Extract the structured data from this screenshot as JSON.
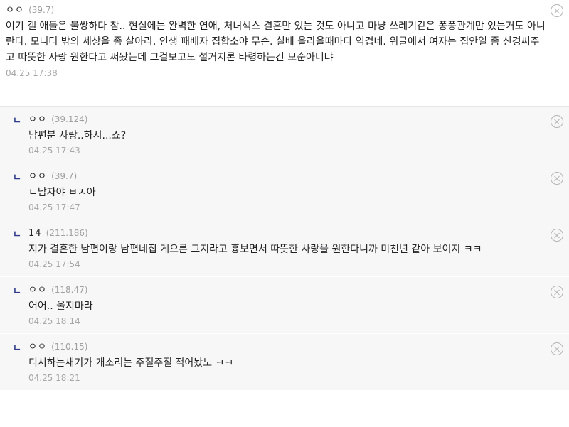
{
  "main_comment": {
    "author": "ㅇㅇ",
    "ip": "(39.7)",
    "text": "여기 갤 애들은 불쌍하다 참.. 현실에는 완벽한 연애, 처녀섹스 결혼만 있는 것도 아니고 마냥 쓰레기같은 퐁퐁관계만 있는거도 아니란다. 모니터 밖의 세상을 좀 살아라. 인생 패배자 집합소야 무슨. 실베 올라올때마다 역겹네. 위글에서 여자는 집안일 좀 신경써주고 따뜻한 사랑 원한다고 써놨는데 그걸보고도 설거지론 타령하는건 모순아니냐",
    "date": "04.25 17:38"
  },
  "replies": [
    {
      "arrow": "ㄴ",
      "author": "ㅇㅇ",
      "ip": "(39.124)",
      "text": "남편분 사랑..하시...죠?",
      "date": "04.25 17:43"
    },
    {
      "arrow": "ㄴ",
      "author": "ㅇㅇ",
      "ip": "(39.7)",
      "text": "ㄴ남자야 ㅂㅅ아",
      "date": "04.25 17:47"
    },
    {
      "arrow": "ㄴ",
      "author": "14",
      "ip": "(211.186)",
      "text": "지가 결혼한 남편이랑 남편네집 게으른 그지라고 흉보면서 따뜻한 사랑을 원한다니까 미친년 같아 보이지 ㅋㅋ",
      "date": "04.25 17:54"
    },
    {
      "arrow": "ㄴ",
      "author": "ㅇㅇ",
      "ip": "(118.47)",
      "text": "어어.. 울지마라",
      "date": "04.25 18:14"
    },
    {
      "arrow": "ㄴ",
      "author": "ㅇㅇ",
      "ip": "(110.15)",
      "text": "디시하는새기가 개소리는 주절주절 적어놨노 ㅋㅋ",
      "date": "04.25 18:21"
    }
  ],
  "icons": {
    "delete": "close-circle-icon",
    "reply": "reply-arrow-icon"
  },
  "colors": {
    "reply_bg": "#f7f7f8",
    "reply_arrow": "#2f3b8a",
    "meta_gray": "#a0a0a0"
  }
}
